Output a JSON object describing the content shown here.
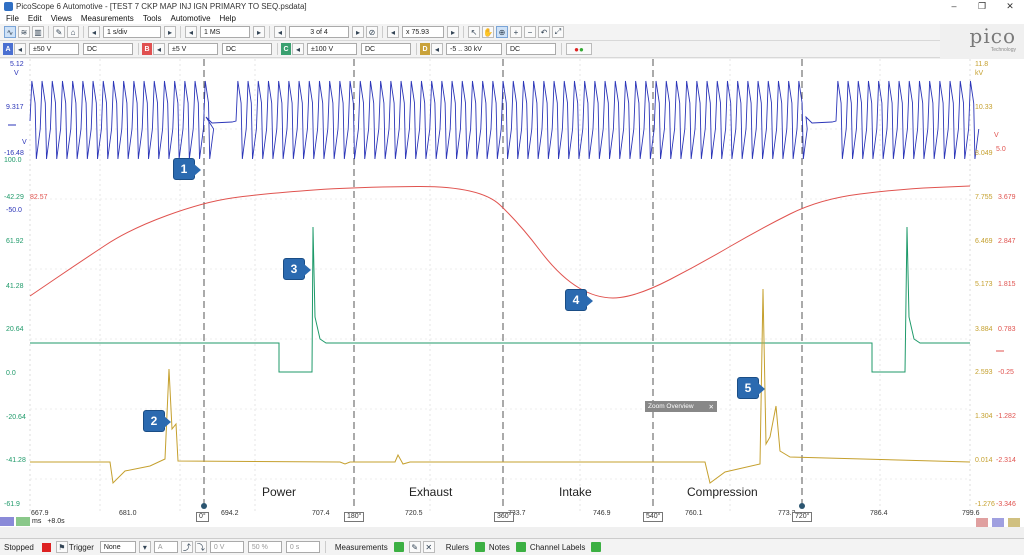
{
  "window": {
    "title": "PicoScope 6 Automotive - [TEST 7 CKP MAP INJ IGN PRIMARY TO SEQ.psdata]",
    "controls": [
      "–",
      "❐",
      "✕"
    ]
  },
  "menu": [
    "File",
    "Edit",
    "Views",
    "Measurements",
    "Tools",
    "Automotive",
    "Help"
  ],
  "toolbar1": {
    "timebase": "1 s/div",
    "samples": "1 MS",
    "buffer": "3 of 4",
    "zoom": "x 75.93"
  },
  "toolbar2": {
    "chA": {
      "label": "A",
      "range": "±50 V",
      "coupling": "DC"
    },
    "chB": {
      "label": "B",
      "range": "±5 V",
      "coupling": "DC"
    },
    "chC": {
      "label": "C",
      "range": "±100 V",
      "coupling": "DC"
    },
    "chD": {
      "label": "D",
      "range": "-5 .. 30 kV",
      "coupling": "DC"
    }
  },
  "logo": {
    "word": "pico",
    "sub": "Technology"
  },
  "left_axis": {
    "top_value": "5.12",
    "values": [
      "9.317",
      "-16.48",
      "100.0",
      "-42.29",
      "82.57",
      "-50.0",
      "61.92",
      "41.28",
      "20.64",
      "0.0",
      "-20.64",
      "-41.28",
      "-61.9"
    ],
    "units": [
      "V",
      "V"
    ]
  },
  "right_axis": {
    "top_value": "11.8",
    "values_a": [
      "10.33",
      "8.049",
      "7.755",
      "6.469",
      "5.173",
      "3.884",
      "2.593",
      "1.304",
      "0.014",
      "-1.276"
    ],
    "values_b": [
      "5.0",
      "3.679",
      "2.847",
      "1.815",
      "0.783",
      "-0.25",
      "-1.282",
      "-2.314",
      "-3.346"
    ],
    "units": [
      "kV",
      "V"
    ]
  },
  "callouts": [
    "1",
    "2",
    "3",
    "4",
    "5"
  ],
  "strokes": [
    "Power",
    "Exhaust",
    "Intake",
    "Compression"
  ],
  "zoom_overview": "Zoom Overview",
  "x_axis": {
    "ticks": [
      "667.9",
      "681.0",
      "694.2",
      "707.4",
      "720.5",
      "733.7",
      "746.9",
      "760.1",
      "773.2",
      "786.4",
      "799.6"
    ],
    "rulers": [
      "0°",
      "180°",
      "360°",
      "540°",
      "720°"
    ],
    "unit": "ms",
    "offset": "+8.0s"
  },
  "statusbar": {
    "state": "Stopped",
    "trigger_label": "Trigger",
    "trigger_value": "None",
    "measurements": "Measurements",
    "rulers": "Rulers",
    "notes": "Notes",
    "channel_labels": "Channel Labels"
  }
}
